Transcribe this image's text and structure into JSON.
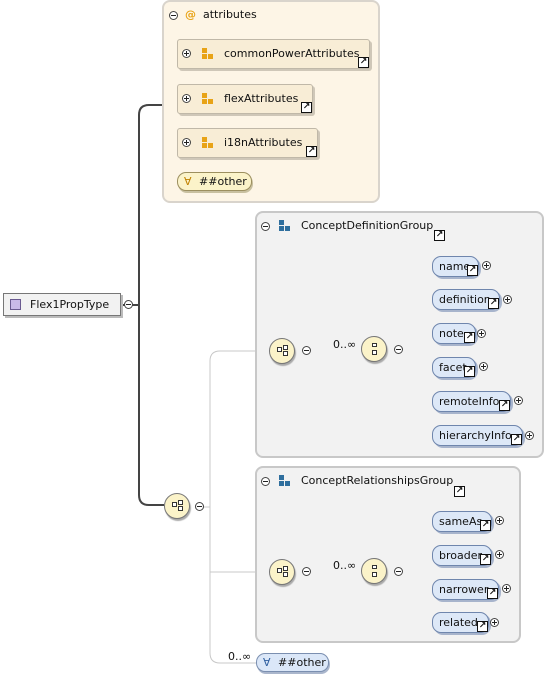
{
  "root": {
    "name": "Flex1PropType"
  },
  "attributes_panel": {
    "title": "attributes",
    "at_symbol": "@",
    "groups": [
      {
        "label": "commonPowerAttributes"
      },
      {
        "label": "flexAttributes"
      },
      {
        "label": "i18nAttributes"
      }
    ],
    "any_attribute": "##other"
  },
  "groups": [
    {
      "title": "ConceptDefinitionGroup",
      "occurrence": "0..∞",
      "elements": [
        "name",
        "definition",
        "note",
        "facet",
        "remoteInfo",
        "hierarchyInfo"
      ]
    },
    {
      "title": "ConceptRelationshipsGroup",
      "occurrence": "0..∞",
      "elements": [
        "sameAs",
        "broader",
        "narrower",
        "related"
      ]
    }
  ],
  "any_element": {
    "occurrence": "0..∞",
    "label": "##other"
  },
  "icons": {
    "ref_arrow": "↗",
    "any_symbol": "∀"
  },
  "colors": {
    "attribute_panel_bg": "#fdf5e6",
    "element_bg": "#dde8f7",
    "compositor_bg": "#fbf3c9",
    "group_icon": "#2f6f9e",
    "attr_group_icon": "#e8a317"
  }
}
